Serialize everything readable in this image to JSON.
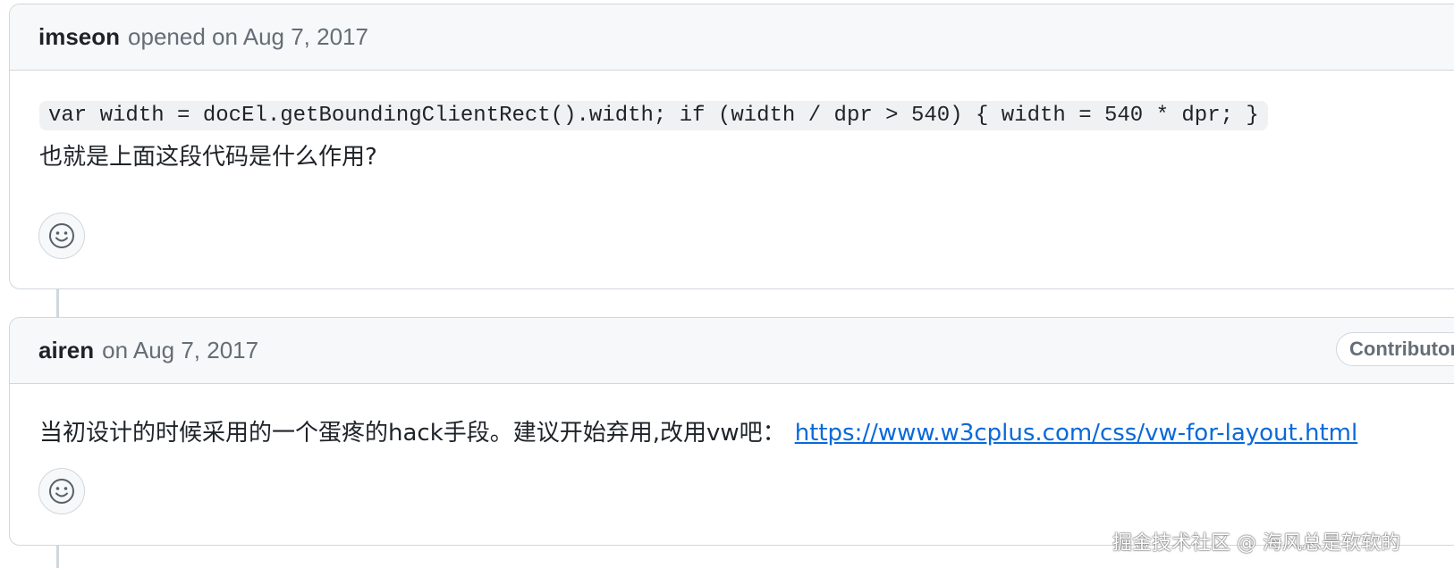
{
  "comments": [
    {
      "author": "imseon",
      "meta": "opened on Aug 7, 2017",
      "code": "var width = docEl.getBoundingClientRect().width; if (width / dpr > 540) { width = 540 * dpr; }",
      "text": "也就是上面这段代码是什么作用?",
      "reaction_icon": "smiley-icon"
    },
    {
      "author": "airen",
      "meta": "on Aug 7, 2017",
      "role": "Contributor",
      "text": "当初设计的时候采用的一个蛋疼的hack手段。建议开始弃用,改用vw吧：",
      "link": "https://www.w3cplus.com/css/vw-for-layout.html",
      "reaction_icon": "smiley-icon"
    }
  ],
  "watermark": "掘金技术社区 @ 海风总是软软的",
  "colors": {
    "border": "#d0d7de",
    "header_bg": "#f6f8fa",
    "link": "#0969da",
    "muted": "#656d76"
  }
}
